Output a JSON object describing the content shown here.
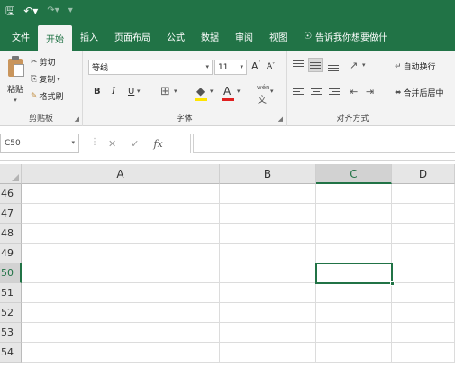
{
  "quick_access": {
    "save_icon": "save-icon",
    "undo_icon": "undo-icon",
    "redo_icon": "redo-icon",
    "customize_icon": "customize-icon"
  },
  "tabs": [
    {
      "label": "文件"
    },
    {
      "label": "开始"
    },
    {
      "label": "插入"
    },
    {
      "label": "页面布局"
    },
    {
      "label": "公式"
    },
    {
      "label": "数据"
    },
    {
      "label": "审阅"
    },
    {
      "label": "视图"
    }
  ],
  "tell_me": "告诉我你想要做什",
  "ribbon": {
    "clipboard": {
      "label": "剪贴板",
      "paste": "粘贴",
      "cut": "剪切",
      "copy": "复制",
      "format_painter": "格式刷"
    },
    "font": {
      "label": "字体",
      "font_name": "等线",
      "font_size": "11",
      "grow": "A",
      "shrink": "A",
      "bold": "B",
      "italic": "I",
      "underline": "U",
      "font_color": "A",
      "phonetic": "wén"
    },
    "alignment": {
      "label": "对齐方式",
      "wrap_text": "自动换行",
      "merge_center": "合并后居中"
    }
  },
  "formula_bar": {
    "name_box": "C50",
    "cancel": "✕",
    "enter": "✓",
    "fx": "fx"
  },
  "sheet": {
    "columns": [
      "A",
      "B",
      "C",
      "D"
    ],
    "selected_column": "C",
    "rows": [
      "46",
      "47",
      "48",
      "49",
      "50",
      "51",
      "52",
      "53",
      "54"
    ],
    "selected_row": "50",
    "active_cell": "C50"
  },
  "colors": {
    "accent": "#217346",
    "ribbon_bg": "#f3f3f3"
  }
}
